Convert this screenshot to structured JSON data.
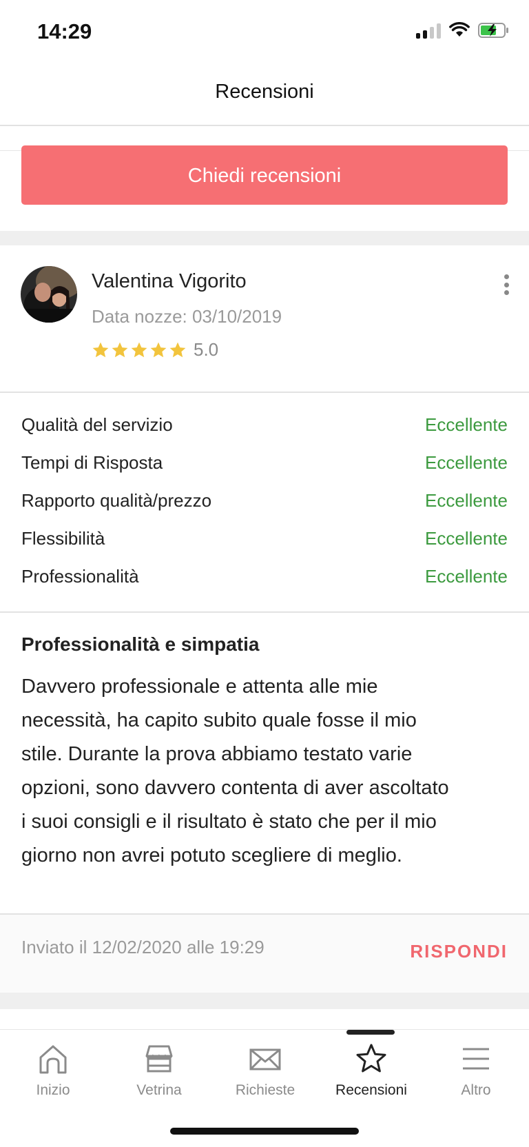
{
  "status_bar": {
    "time": "14:29"
  },
  "header": {
    "title": "Recensioni"
  },
  "cta": {
    "label": "Chiedi recensioni",
    "color": "#f66f73"
  },
  "review": {
    "reviewer_name": "Valentina Vigorito",
    "wedding_date": "Data nozze: 03/10/2019",
    "rating": "5.0",
    "rating_stars": 5,
    "criteria": [
      {
        "label": "Qualità del servizio",
        "value": "Eccellente"
      },
      {
        "label": "Tempi di Risposta",
        "value": "Eccellente"
      },
      {
        "label": "Rapporto qualità/prezzo",
        "value": "Eccellente"
      },
      {
        "label": "Flessibilità",
        "value": "Eccellente"
      },
      {
        "label": "Professionalità",
        "value": "Eccellente"
      }
    ],
    "title": "Professionalità e simpatia",
    "text_lines": [
      "Davvero professionale e attenta alle mie",
      "necessità, ha capito subito quale fosse il mio",
      "stile. Durante la prova abbiamo testato varie",
      "opzioni, sono davvero contenta di aver ascoltato",
      "i suoi consigli e il risultato è stato che per il mio",
      "giorno non avrei potuto scegliere di meglio."
    ],
    "sent_info": "Inviato il 12/02/2020 alle 19:29",
    "reply_label": "RISPONDI"
  },
  "tab_bar": {
    "tabs": [
      {
        "label": "Inizio",
        "icon": "home-icon"
      },
      {
        "label": "Vetrina",
        "icon": "storefront-icon"
      },
      {
        "label": "Richieste",
        "icon": "envelope-icon"
      },
      {
        "label": "Recensioni",
        "icon": "star-icon",
        "active": true
      },
      {
        "label": "Altro",
        "icon": "menu-icon"
      }
    ]
  },
  "colors": {
    "accent": "#f66f73",
    "excellent": "#3c9a3f",
    "star": "#f2c43d"
  }
}
